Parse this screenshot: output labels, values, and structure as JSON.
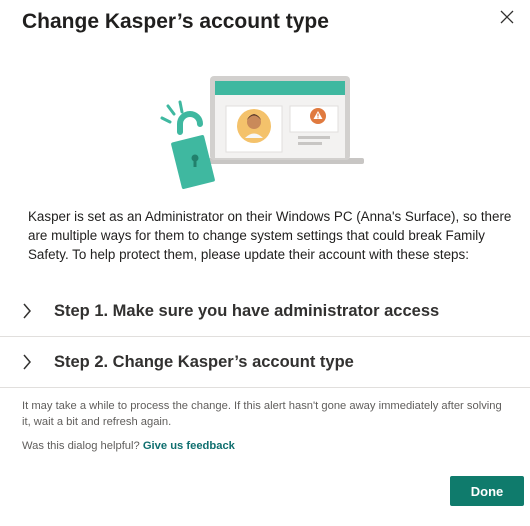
{
  "dialog": {
    "title": "Change Kasper’s account type",
    "close_icon": "close-icon",
    "body": "Kasper is set as an Administrator on their Windows PC (Anna's Surface), so there are multiple ways for them to change system settings that could break Family Safety. To help protect them, please update their account with these steps:",
    "steps": [
      {
        "label": "Step 1. Make sure you have administrator access",
        "icon": "chevron-right-icon"
      },
      {
        "label": "Step 2. Change Kasper’s account type",
        "icon": "chevron-right-icon"
      }
    ],
    "note": "It may take a while to process the change. If this alert hasn't gone away immediately after solving it, wait a bit and refresh again.",
    "feedback_prompt": "Was this dialog helpful?",
    "feedback_link": "Give us feedback",
    "done_label": "Done"
  },
  "colors": {
    "accent": "#0f7b6c",
    "illustration_teal": "#3fb8a0",
    "warning": "#e07a3f"
  }
}
